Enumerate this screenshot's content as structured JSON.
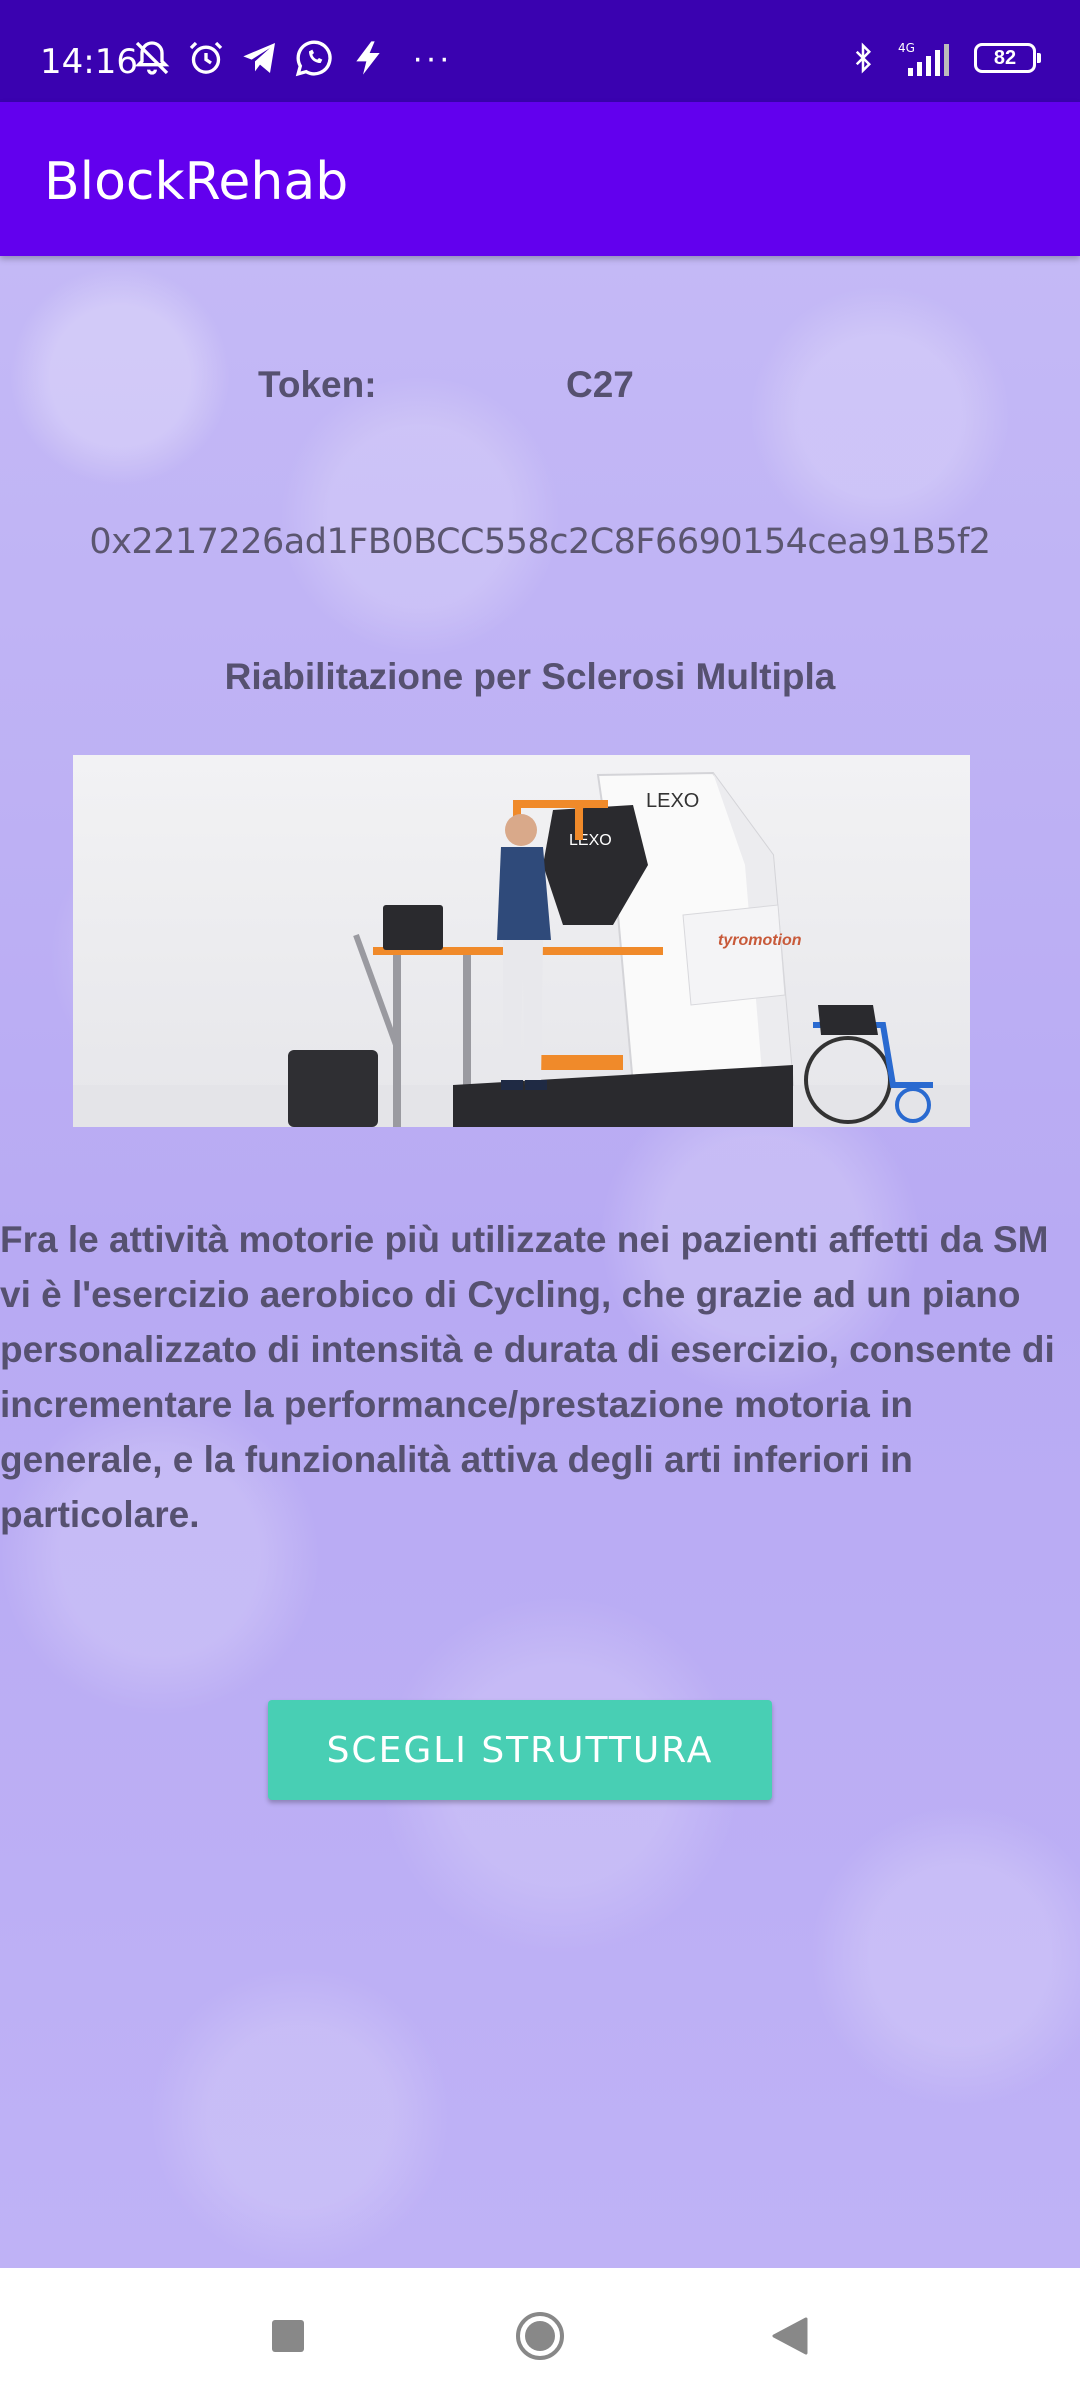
{
  "status_bar": {
    "time": "14:16",
    "network": "4G",
    "battery": "82",
    "more": "···"
  },
  "app_bar": {
    "title": "BlockRehab"
  },
  "content": {
    "token_label": "Token:",
    "token_value": "C27",
    "address": "0x2217226ad1FB0BCC558c2C8F6690154cea91B5f2",
    "rehab_title": "Riabilitazione per Sclerosi Multipla",
    "image_text": {
      "brand_top": "LEXO",
      "brand_body": "LEXO",
      "maker": "tyromotion"
    },
    "description": "Fra le attività motorie più utilizzate nei pazienti affetti da SM vi è l'esercizio aerobico di Cycling, che grazie ad un piano personalizzato di intensità e durata di esercizio, consente di incrementare la performance/prestazione motoria in generale, e la funzionalità attiva degli arti inferiori in particolare.",
    "button_label": "SCEGLI STRUTTURA"
  },
  "colors": {
    "status_bar": "#3a02b0",
    "app_bar": "#6200ee",
    "button": "#48cfb4",
    "text": "#565170"
  }
}
